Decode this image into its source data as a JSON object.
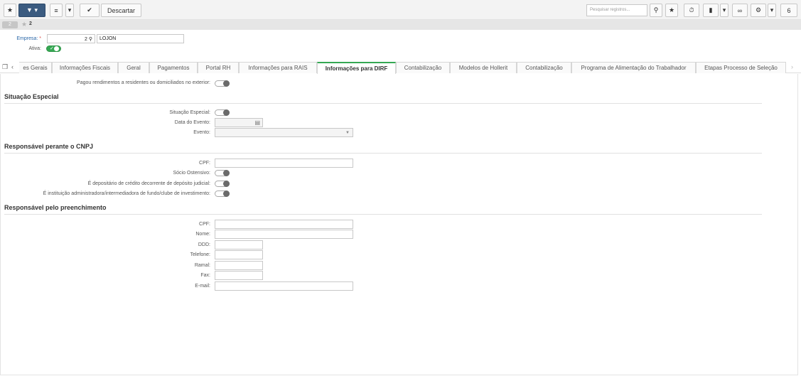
{
  "toolbar": {
    "home_icon": "home-icon",
    "discard_label": "Descartar",
    "search_placeholder": "Pesquisar registros...",
    "counter": "6"
  },
  "record": {
    "number": "2",
    "code": "2"
  },
  "header": {
    "empresa_label": "Empresa:",
    "required_mark": "*",
    "empresa_code": "2",
    "empresa_name": "LOJON",
    "ativa_label": "Ativa:"
  },
  "tabs": [
    {
      "label": "es Gerais"
    },
    {
      "label": "Informações Fiscais"
    },
    {
      "label": "Geral"
    },
    {
      "label": "Pagamentos"
    },
    {
      "label": "Portal RH"
    },
    {
      "label": "Informações para RAIS"
    },
    {
      "label": "Informações para DIRF"
    },
    {
      "label": "Contabilização"
    },
    {
      "label": "Modelos de Hollerit"
    },
    {
      "label": "Contabilização"
    },
    {
      "label": "Programa de Alimentação do Trabalhador"
    },
    {
      "label": "Etapas Processo de Seleção"
    }
  ],
  "form": {
    "pagou_label": "Pagou rendimentos a residentes ou domiciliados no exterior:",
    "situacao_section": "Situação Especial",
    "situacao_label": "Situação Especial:",
    "data_evento_label": "Data do Evento:",
    "evento_label": "Evento:",
    "cnpj_section": "Responsável perante o CNPJ",
    "cpf_label": "CPF:",
    "socio_label": "Sócio Ostensivo:",
    "depositario_label": "É depositário de crédito decorrente de depósito judicial:",
    "instituicao_label": "É instituição administradora/intermediadora de fundo/clube de investimento:",
    "preench_section": "Responsável pelo preenchimento",
    "cpf2_label": "CPF:",
    "nome_label": "Nome:",
    "ddd_label": "DDD:",
    "telefone_label": "Telefone:",
    "ramal_label": "Ramal:",
    "fax_label": "Fax:",
    "email_label": "E-mail:"
  },
  "colors": {
    "accent_green": "#35a853",
    "toolbar_dark": "#3b5b80"
  }
}
